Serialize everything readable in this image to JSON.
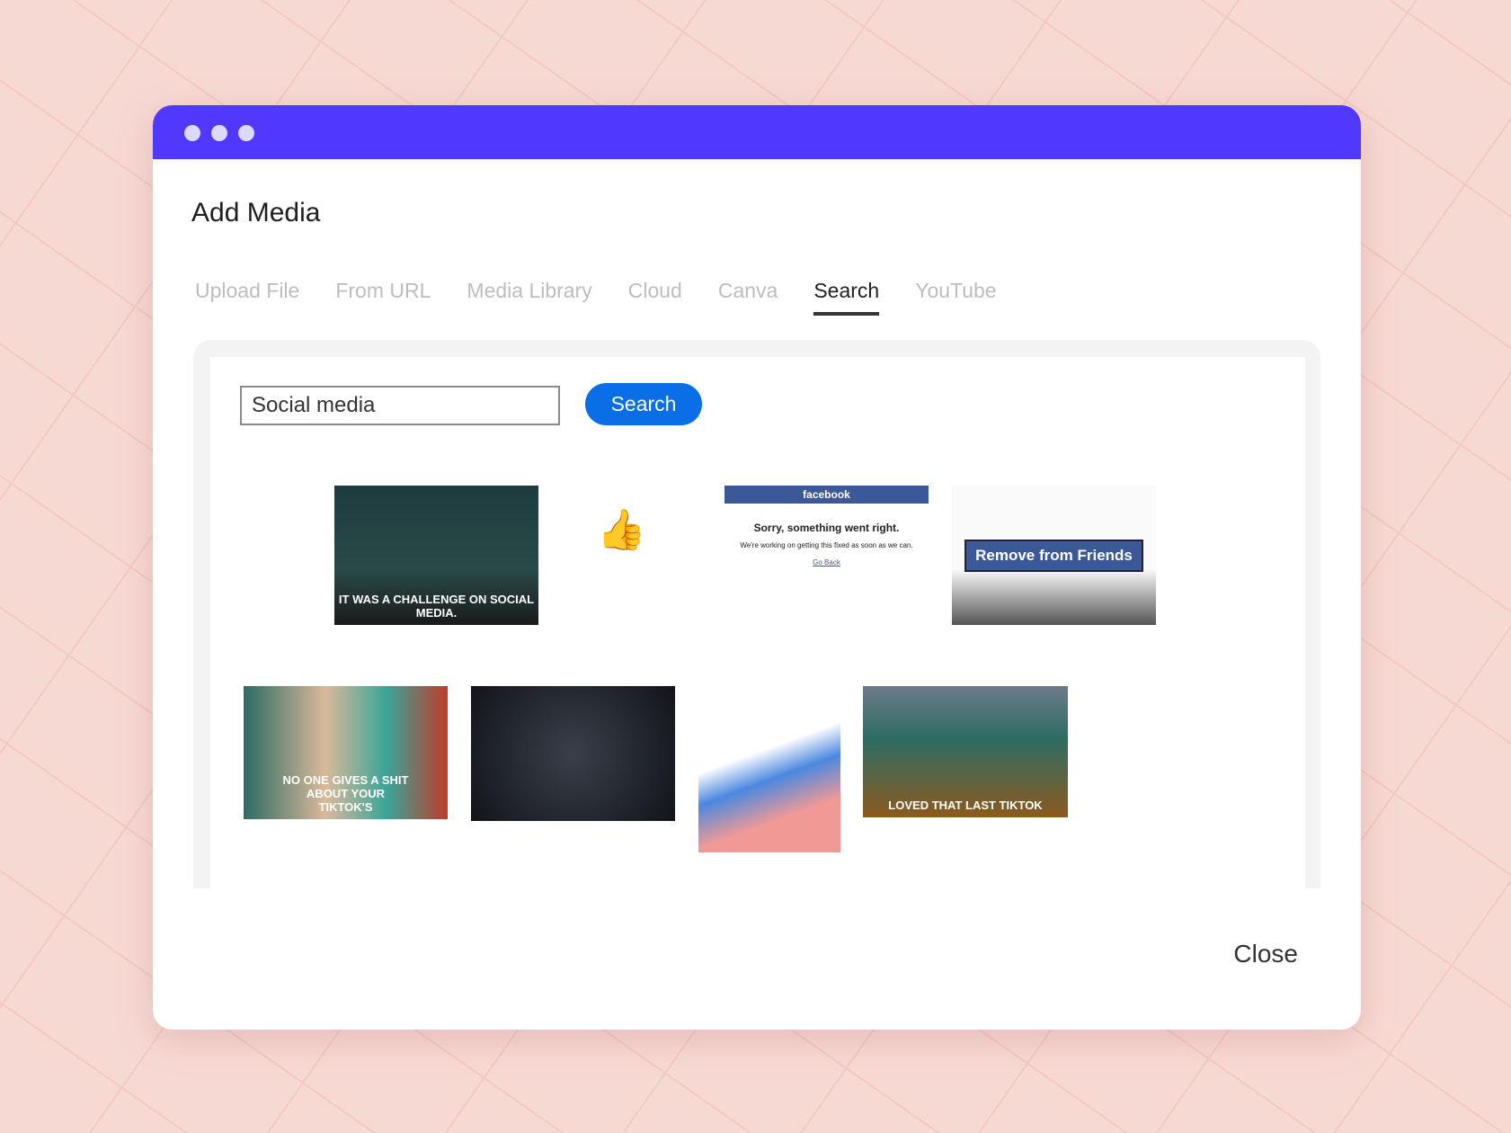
{
  "window": {
    "accent": "#5038ff",
    "title": "Add Media"
  },
  "tabs": [
    {
      "label": "Upload File"
    },
    {
      "label": "From URL"
    },
    {
      "label": "Media Library"
    },
    {
      "label": "Cloud"
    },
    {
      "label": "Canva"
    },
    {
      "label": "Search",
      "active": true
    },
    {
      "label": "YouTube"
    }
  ],
  "search": {
    "value": "Social media",
    "button_label": "Search",
    "button_color": "#0a6ee6"
  },
  "results": [
    {
      "caption": "IT WAS A CHALLENGE ON SOCIAL MEDIA."
    },
    {
      "caption": ""
    },
    {
      "caption": "Sorry, something went right.",
      "header": "facebook",
      "sub": "We're working on getting this fixed as soon as we can.",
      "link": "Go Back"
    },
    {
      "caption": "Remove from Friends"
    },
    {
      "caption": "NO ONE GIVES A SHIT ABOUT YOUR TIKTOK'S"
    },
    {
      "caption": ""
    },
    {
      "caption": ""
    },
    {
      "caption": "LOVED THAT LAST TIKTOK"
    }
  ],
  "footer": {
    "close_label": "Close"
  }
}
